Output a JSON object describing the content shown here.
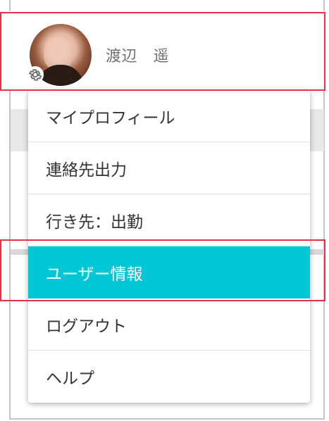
{
  "header": {
    "user_name": "渡辺　遥",
    "avatar_alt": "",
    "settings_icon": "gear-icon"
  },
  "menu": {
    "items": [
      {
        "label": "マイプロフィール",
        "active": false
      },
      {
        "label": "連絡先出力",
        "active": false
      },
      {
        "label": "行き先：出勤",
        "active": false
      },
      {
        "label": "ユーザー情報",
        "active": true
      },
      {
        "label": "ログアウト",
        "active": false
      },
      {
        "label": "ヘルプ",
        "active": false
      }
    ]
  },
  "colors": {
    "accent": "#00c7d5",
    "highlight_border": "#e63344",
    "text": "#333333",
    "muted_text": "#6f6f6f"
  }
}
